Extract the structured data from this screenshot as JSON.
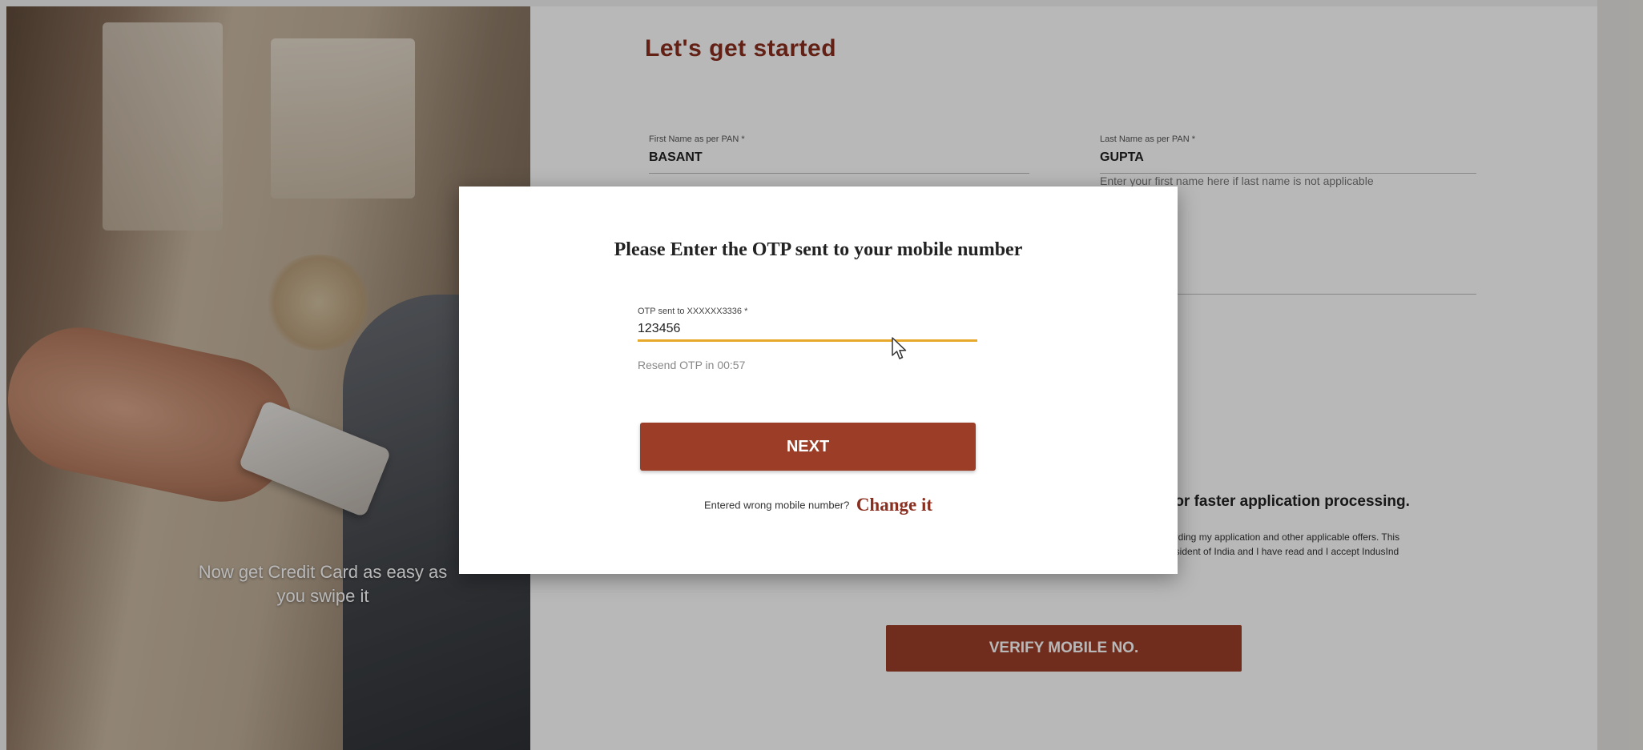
{
  "hero": {
    "caption_line1": "Now get Credit Card as easy as",
    "caption_line2": "you swipe it"
  },
  "form": {
    "title": "Let's get started",
    "first_name": {
      "label": "First Name as per PAN *",
      "value": "BASANT"
    },
    "last_name": {
      "label": "Last Name as per PAN *",
      "value": "GUPTA",
      "hint": "Enter your first name here if last name is not applicable"
    },
    "faster_text": "for faster application processing.",
    "consent_line1": "arding my application and other applicable offers. This",
    "consent_line2": "esident of India and I have read and I accept IndusInd",
    "verify_button": "VERIFY MOBILE NO."
  },
  "modal": {
    "title": "Please Enter the OTP sent to your mobile number",
    "otp_label": "OTP sent to XXXXXX3336 *",
    "otp_value": "123456",
    "resend_text": "Resend OTP in 00:57",
    "next_button": "NEXT",
    "wrong_number_text": "Entered wrong mobile number?",
    "change_link": "Change it"
  },
  "colors": {
    "accent": "#9b3d27",
    "title": "#8a2f1f",
    "focus_underline": "#e8a92a"
  },
  "icons": {
    "pointer": "mouse-cursor-icon"
  }
}
